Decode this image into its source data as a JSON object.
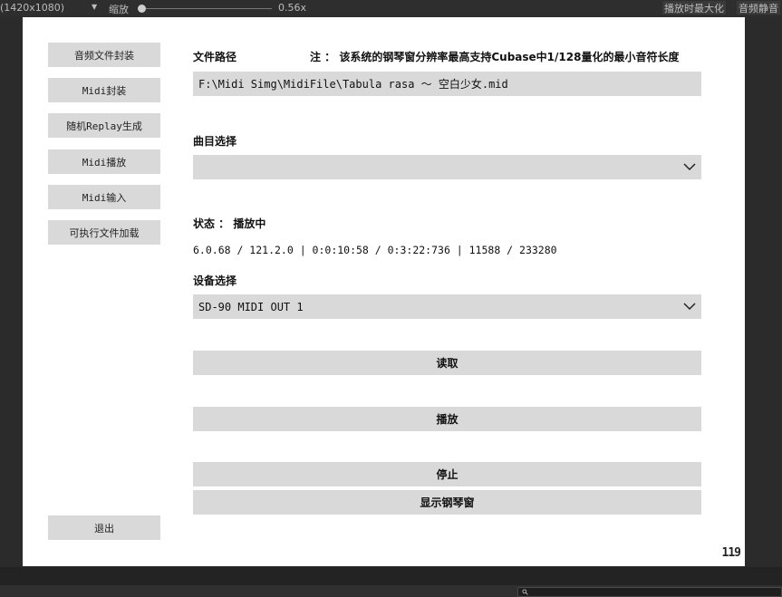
{
  "editor": {
    "resolution": "(1420x1080)",
    "zoom_label": "缩放",
    "zoom_value": "0.56x",
    "zoom_level": 0.56,
    "maximize_on_play": "播放时最大化",
    "mute_audio": "音频静音"
  },
  "sidebar": {
    "items": [
      {
        "label": "音频文件封装"
      },
      {
        "label": "Midi封装"
      },
      {
        "label": "随机Replay生成"
      },
      {
        "label": "Midi播放"
      },
      {
        "label": "Midi输入"
      },
      {
        "label": "可执行文件加载"
      }
    ],
    "exit_label": "退出"
  },
  "main": {
    "file_path_label": "文件路径",
    "note": "注 ： 该系统的钢琴窗分辨率最高支持Cubase中1/128量化的最小音符长度",
    "file_path_value": "F:\\Midi Simg\\MidiFile\\Tabula rasa ～ 空白少女.mid",
    "track_select_label": "曲目选择",
    "track_select_value": "",
    "status_label": "状态 ： 播放中",
    "status_line": "6.0.68 / 121.2.0 | 0:0:10:58 / 0:3:22:736 | 11588 / 233280",
    "device_label": "设备选择",
    "device_value": "SD-90 MIDI OUT 1",
    "read_button": "读取",
    "play_button": "播放",
    "stop_button": "停止",
    "piano_button": "显示钢琴窗"
  },
  "fps": "119",
  "colors": {
    "editor_bg": "#2b2b2b",
    "button_bg": "#d9d9d9",
    "game_bg": "#ffffff"
  }
}
